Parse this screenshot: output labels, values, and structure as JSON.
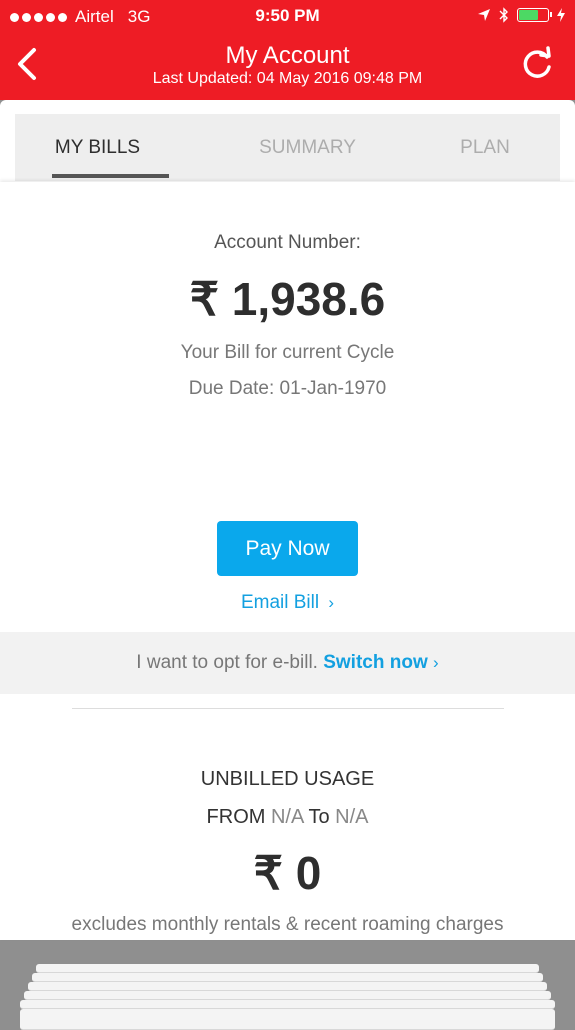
{
  "status_bar": {
    "carrier": "Airtel",
    "network": "3G",
    "time": "9:50 PM",
    "battery_percent": 70,
    "battery_color": "#4cd964"
  },
  "header": {
    "title": "My Account",
    "last_updated": "Last Updated: 04 May 2016 09:48 PM",
    "back_icon": "chevron-left-icon",
    "refresh_icon": "refresh-icon",
    "bg_color": "#ee1c25"
  },
  "tabs": [
    {
      "label": "MY BILLS",
      "active": true
    },
    {
      "label": "SUMMARY",
      "active": false
    },
    {
      "label": "PLAN",
      "active": false
    }
  ],
  "bill": {
    "account_label": "Account Number:",
    "amount": "₹ 1,938.6",
    "cycle_text": "Your Bill for current Cycle",
    "due_date": "Due Date: 01-Jan-1970",
    "pay_button": "Pay Now",
    "email_bill": "Email Bill",
    "email_chevron": "›"
  },
  "ebill": {
    "prompt": "I want to opt for e-bill.",
    "link": "Switch now",
    "chevron": "›"
  },
  "unbilled": {
    "heading": "UNBILLED USAGE",
    "from_label": "FROM",
    "from_value": "N/A",
    "to_label": "To",
    "to_value": "N/A",
    "amount": "₹ 0",
    "note": "excludes monthly rentals & recent roaming charges"
  },
  "colors": {
    "accent_blue": "#0aa8ec",
    "link_blue": "#13a0e0",
    "brand_red": "#ee1c25"
  }
}
